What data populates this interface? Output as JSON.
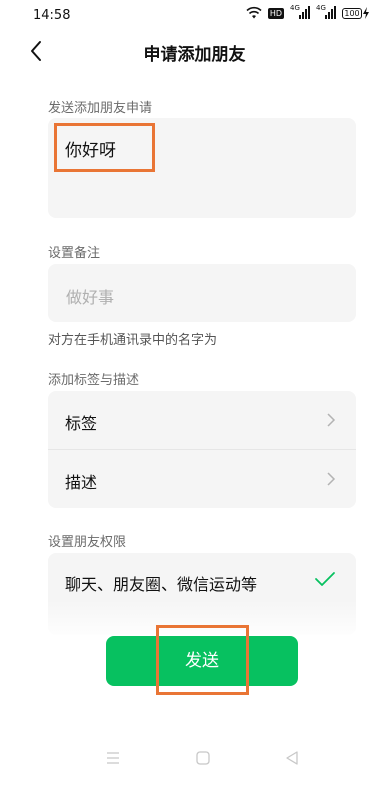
{
  "status_bar": {
    "time": "14:58",
    "hd_badge": "HD",
    "network_1": "4G",
    "network_2": "4G",
    "battery": "100"
  },
  "header": {
    "back_icon": "chevron-left-icon",
    "title": "申请添加朋友"
  },
  "request_section": {
    "label": "发送添加朋友申请",
    "message": "你好呀"
  },
  "remark_section": {
    "label": "设置备注",
    "placeholder": "做好事",
    "note": "对方在手机通讯录中的名字为"
  },
  "tags_section": {
    "label": "添加标签与描述",
    "items": [
      {
        "label": "标签",
        "icon": "chevron-right-icon"
      },
      {
        "label": "描述",
        "icon": "chevron-right-icon"
      }
    ]
  },
  "permission_section": {
    "label": "设置朋友权限",
    "option": "聊天、朋友圈、微信运动等",
    "selected": true,
    "icon": "checkmark-icon"
  },
  "send_button": {
    "label": "发送"
  },
  "colors": {
    "accent_green": "#07c160",
    "highlight_orange": "#e97535",
    "card_bg": "#f5f5f5"
  },
  "nav_bar": {
    "icons": [
      "menu-icon",
      "home-icon",
      "back-triangle-icon"
    ]
  }
}
